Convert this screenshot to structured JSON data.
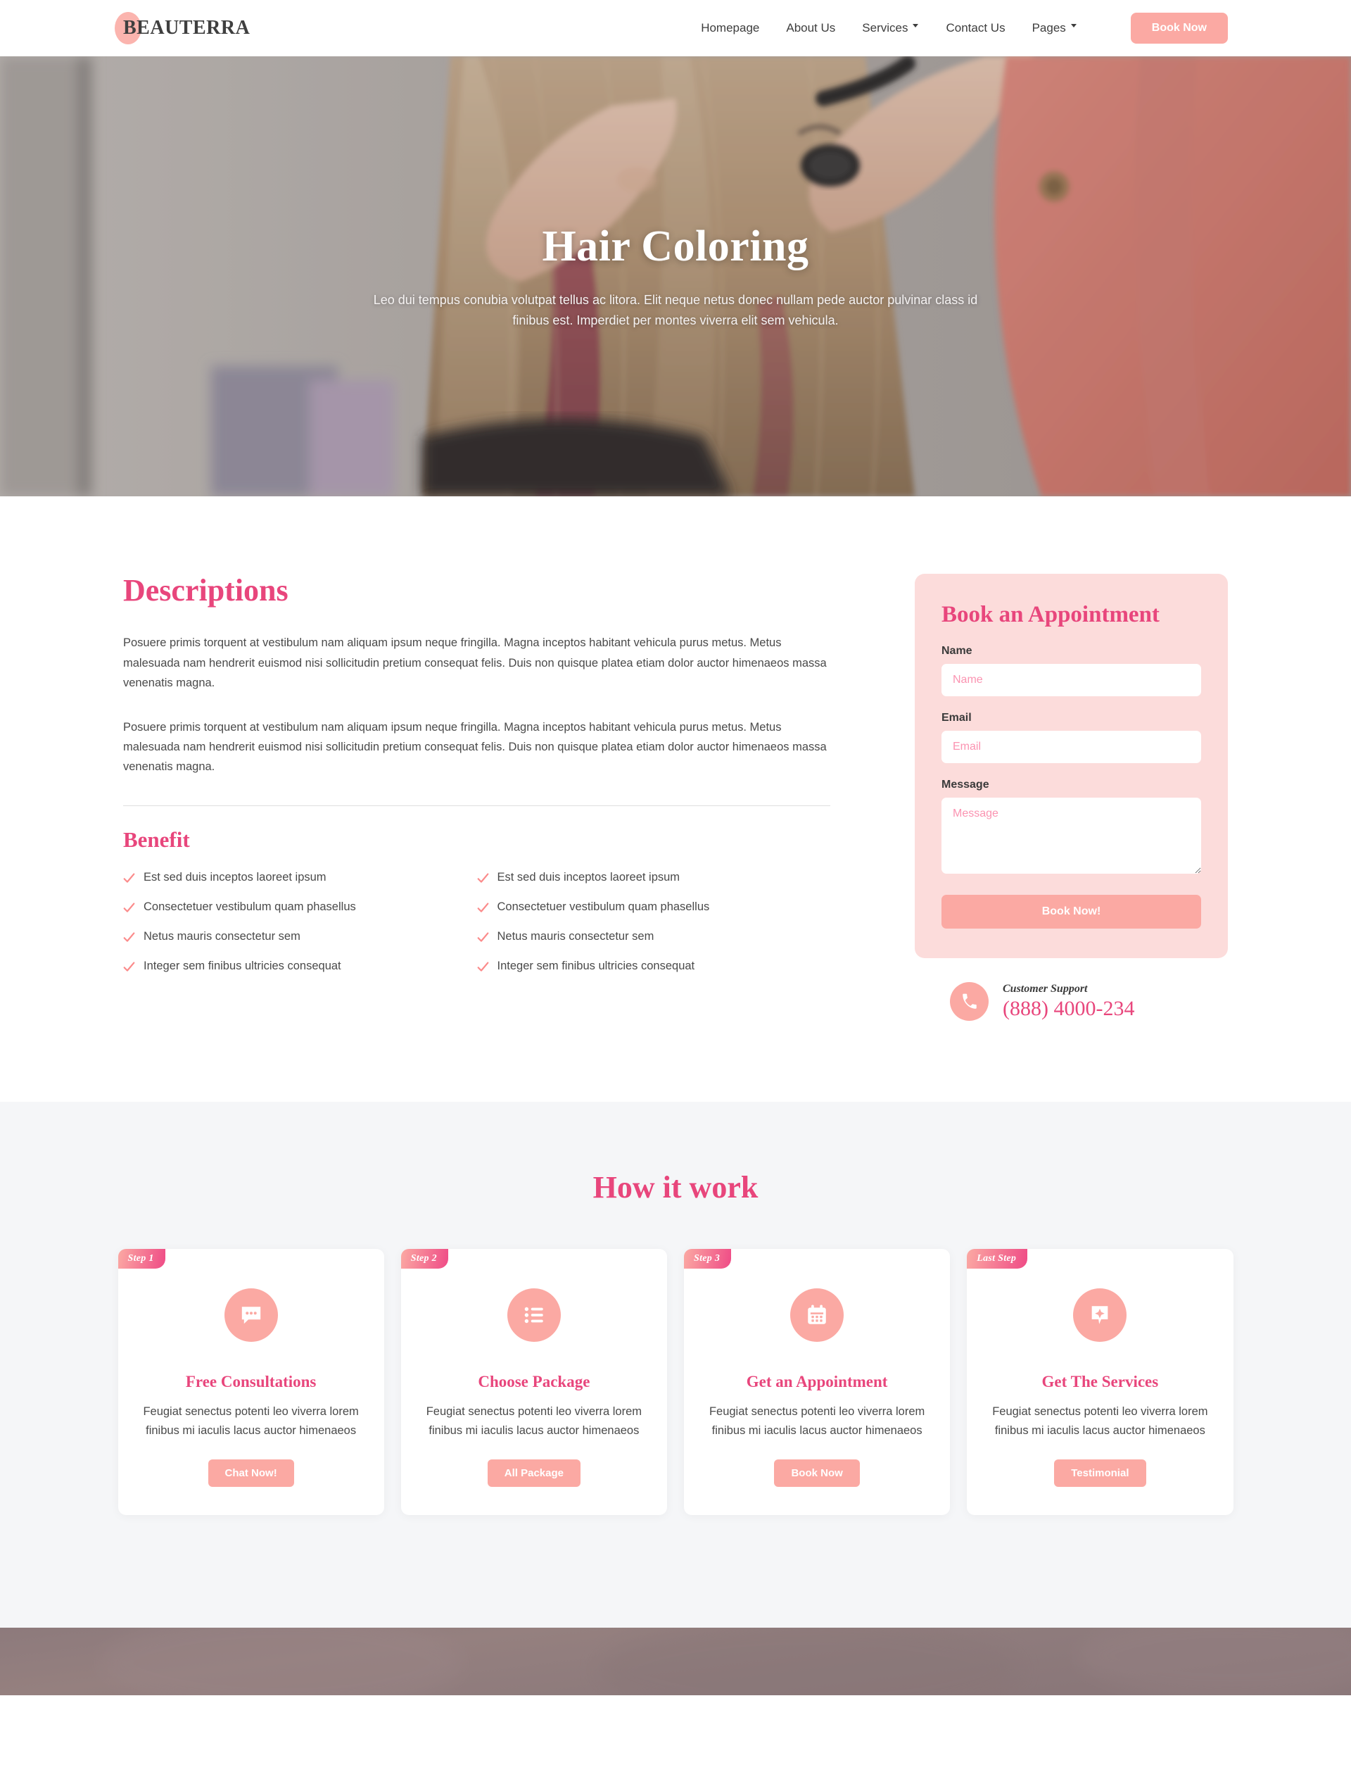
{
  "header": {
    "logo_text": "BEAUTERRA",
    "nav": [
      {
        "label": "Homepage",
        "has_dropdown": false
      },
      {
        "label": "About Us",
        "has_dropdown": false
      },
      {
        "label": "Services",
        "has_dropdown": true
      },
      {
        "label": "Contact Us",
        "has_dropdown": false
      },
      {
        "label": "Pages",
        "has_dropdown": true
      }
    ],
    "cta_label": "Book Now"
  },
  "hero": {
    "title": "Hair Coloring",
    "subtitle": "Leo dui tempus conubia volutpat tellus ac litora. Elit neque netus donec nullam pede auctor pulvinar class id finibus est. Imperdiet per montes viverra elit sem vehicula."
  },
  "descriptions": {
    "heading": "Descriptions",
    "paragraphs": [
      "Posuere primis torquent at vestibulum nam aliquam ipsum neque fringilla. Magna inceptos habitant vehicula purus metus. Metus malesuada nam hendrerit euismod nisi sollicitudin pretium consequat felis. Duis non quisque platea etiam dolor auctor himenaeos massa venenatis magna.",
      "Posuere primis torquent at vestibulum nam aliquam ipsum neque fringilla. Magna inceptos habitant vehicula purus metus. Metus malesuada nam hendrerit euismod nisi sollicitudin pretium consequat felis. Duis non quisque platea etiam dolor auctor himenaeos massa venenatis magna."
    ]
  },
  "benefit": {
    "heading": "Benefit",
    "column_left": [
      "Est sed duis inceptos laoreet ipsum",
      "Consectetuer vestibulum quam phasellus",
      "Netus mauris consectetur sem",
      "Integer sem finibus ultricies consequat"
    ],
    "column_right": [
      "Est sed duis inceptos laoreet ipsum",
      "Consectetuer vestibulum quam phasellus",
      "Netus mauris consectetur sem",
      "Integer sem finibus ultricies consequat"
    ]
  },
  "appointment": {
    "title": "Book an Appointment",
    "name_label": "Name",
    "name_placeholder": "Name",
    "name_value": "",
    "email_label": "Email",
    "email_placeholder": "Email",
    "email_value": "",
    "message_label": "Message",
    "message_placeholder": "Message",
    "message_value": "",
    "submit_label": "Book Now!"
  },
  "support": {
    "label": "Customer Support",
    "phone": "(888) 4000-234"
  },
  "how_it_work": {
    "title": "How it work",
    "cards": [
      {
        "badge": "Step 1",
        "icon": "chat-bubble-icon",
        "title": "Free Consultations",
        "description": "Feugiat senectus potenti leo viverra lorem finibus mi iaculis lacus auctor himenaeos",
        "button": "Chat Now!"
      },
      {
        "badge": "Step 2",
        "icon": "list-icon",
        "title": "Choose Package",
        "description": "Feugiat senectus potenti leo viverra lorem finibus mi iaculis lacus auctor himenaeos",
        "button": "All Package"
      },
      {
        "badge": "Step 3",
        "icon": "calendar-icon",
        "title": "Get an Appointment",
        "description": "Feugiat senectus potenti leo viverra lorem finibus mi iaculis lacus auctor himenaeos",
        "button": "Book Now"
      },
      {
        "badge": "Last Step",
        "icon": "sparkle-badge-icon",
        "title": "Get The Services",
        "description": "Feugiat senectus potenti leo viverra lorem finibus mi iaculis lacus auctor himenaeos",
        "button": "Testimonial"
      }
    ]
  },
  "colors": {
    "accent_pink": "#e8467c",
    "salmon": "#fba9a3",
    "card_bg": "#fcdcdb",
    "section_bg": "#f5f6f8"
  }
}
